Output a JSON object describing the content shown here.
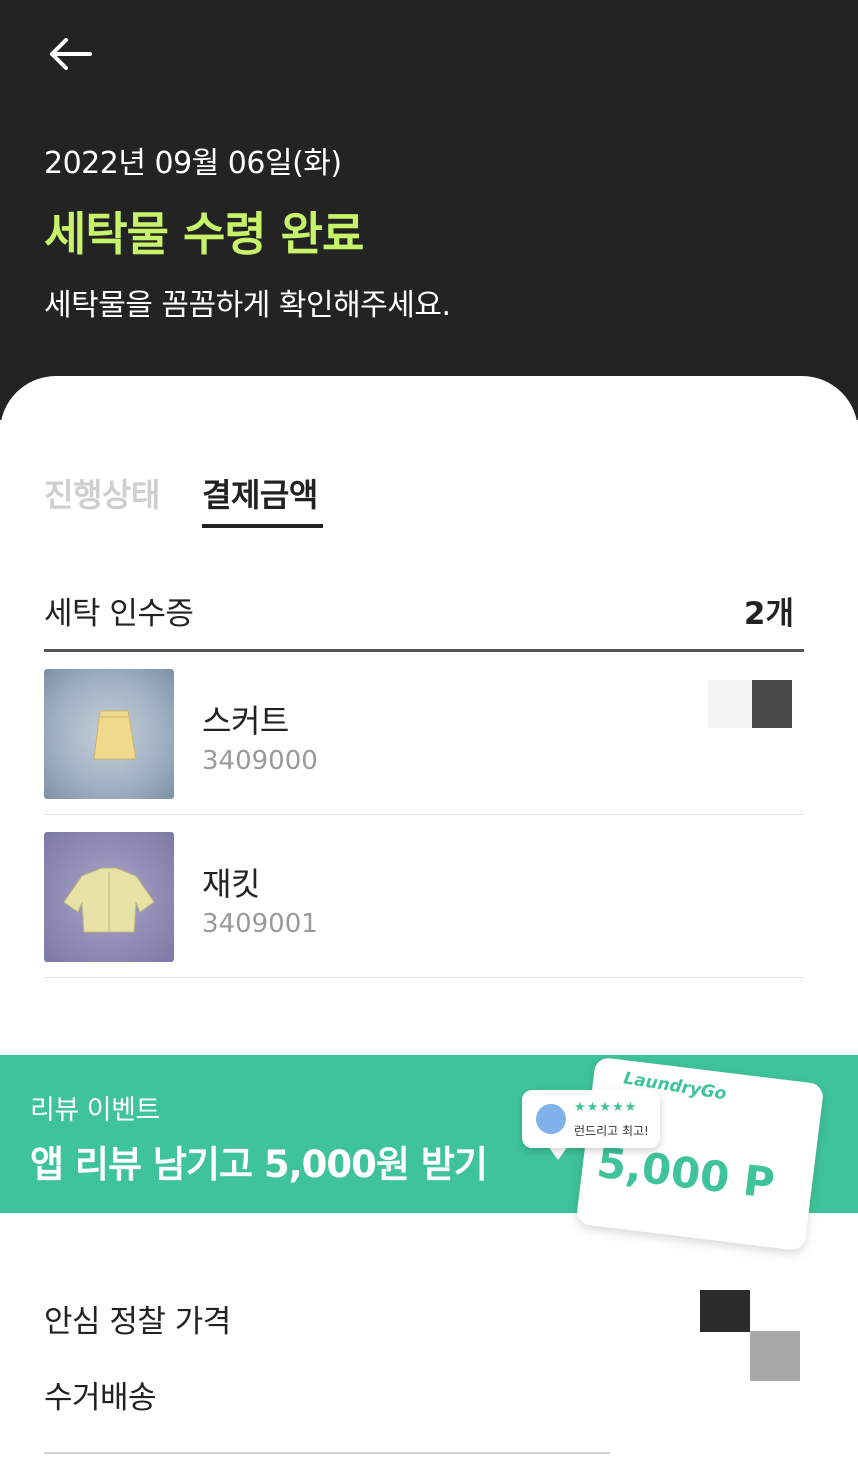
{
  "header": {
    "date": "2022년 09월 06일(화)",
    "status": "세탁물 수령 완료",
    "subtitle": "세탁물을 꼼꼼하게 확인해주세요."
  },
  "tabs": [
    {
      "label": "진행상태",
      "active": false
    },
    {
      "label": "결제금액",
      "active": true
    }
  ],
  "receipt": {
    "title": "세탁 인수증",
    "count": "2개",
    "items": [
      {
        "name": "스커트",
        "code": "3409000",
        "icon": "skirt-image"
      },
      {
        "name": "재킷",
        "code": "3409001",
        "icon": "jacket-image"
      }
    ]
  },
  "banner": {
    "small": "리뷰 이벤트",
    "big": "앱 리뷰 남기고 5,000원 받기",
    "card_logo": "LaundryGo",
    "card_amount": "5,000 P",
    "bubble_stars": "★★★★★",
    "bubble_text": "런드리고 최고!",
    "background_color": "#3fc39a"
  },
  "pricing": {
    "items": [
      "안심 정찰 가격",
      "수거배송"
    ]
  },
  "colors": {
    "header_bg": "#232323",
    "status_accent": "#c7f36b",
    "banner_green": "#3fc39a"
  }
}
